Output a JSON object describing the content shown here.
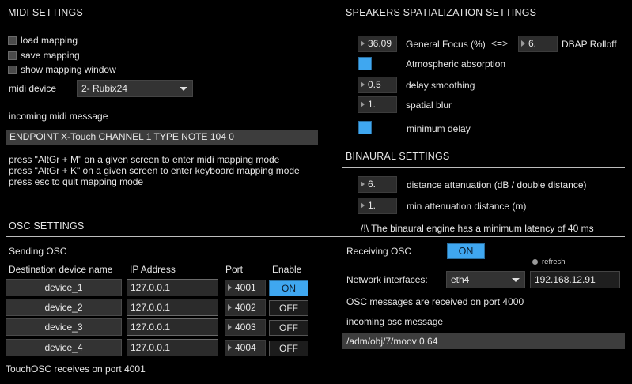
{
  "midi": {
    "title": "MIDI SETTINGS",
    "checkboxes": [
      "load mapping",
      "save mapping",
      "show mapping window"
    ],
    "device_label": "midi device",
    "device_value": "2- Rubix24",
    "incoming_label": "incoming midi message",
    "incoming_value": "ENDPOINT X-Touch CHANNEL 1 TYPE NOTE 104 0",
    "help": [
      "press \"AltGr + M\" on a given screen to enter midi mapping mode",
      "press \"AltGr + K\" on a given screen to enter keyboard mapping mode",
      "press esc to quit mapping mode"
    ]
  },
  "speakers": {
    "title": "SPEAKERS SPATIALIZATION SETTINGS",
    "general_focus_value": "36.09",
    "general_focus_label": "General Focus (%)",
    "link_symbol": "<=>",
    "dbap_value": "6.",
    "dbap_label": "DBAP Rolloff",
    "atmospheric_label": "Atmospheric absorption",
    "delay_smoothing_value": "0.5",
    "delay_smoothing_label": "delay smoothing",
    "spatial_blur_value": "1.",
    "spatial_blur_label": "spatial blur",
    "minimum_delay_label": "minimum delay"
  },
  "binaural": {
    "title": "BINAURAL SETTINGS",
    "distance_att_value": "6.",
    "distance_att_label": "distance attenuation (dB / double distance)",
    "min_att_value": "1.",
    "min_att_label": "min attenuation distance (m)",
    "note": "/!\\ The binaural engine has a minimum latency of 40 ms"
  },
  "osc": {
    "title": "OSC SETTINGS",
    "sending_label": "Sending OSC",
    "columns": [
      "Destination device name",
      "IP Address",
      "Port",
      "Enable"
    ],
    "devices": [
      {
        "name": "device_1",
        "ip": "127.0.0.1",
        "port": "4001",
        "enable": "ON"
      },
      {
        "name": "device_2",
        "ip": "127.0.0.1",
        "port": "4002",
        "enable": "OFF"
      },
      {
        "name": "device_3",
        "ip": "127.0.0.1",
        "port": "4003",
        "enable": "OFF"
      },
      {
        "name": "device_4",
        "ip": "127.0.0.1",
        "port": "4004",
        "enable": "OFF"
      }
    ],
    "touchosc_note": "TouchOSC receives on port 4001",
    "receiving_label": "Receiving OSC",
    "receiving_value": "ON",
    "refresh_label": "refresh",
    "network_label": "Network interfaces:",
    "network_value": "eth4",
    "network_ip": "192.168.12.91",
    "port_note": "OSC messages are received on port 4000",
    "incoming_label": "incoming osc message",
    "incoming_value": "/adm/obj/7/moov 0.64"
  },
  "colors": {
    "accent": "#3fa7f0",
    "background": "#000000"
  }
}
